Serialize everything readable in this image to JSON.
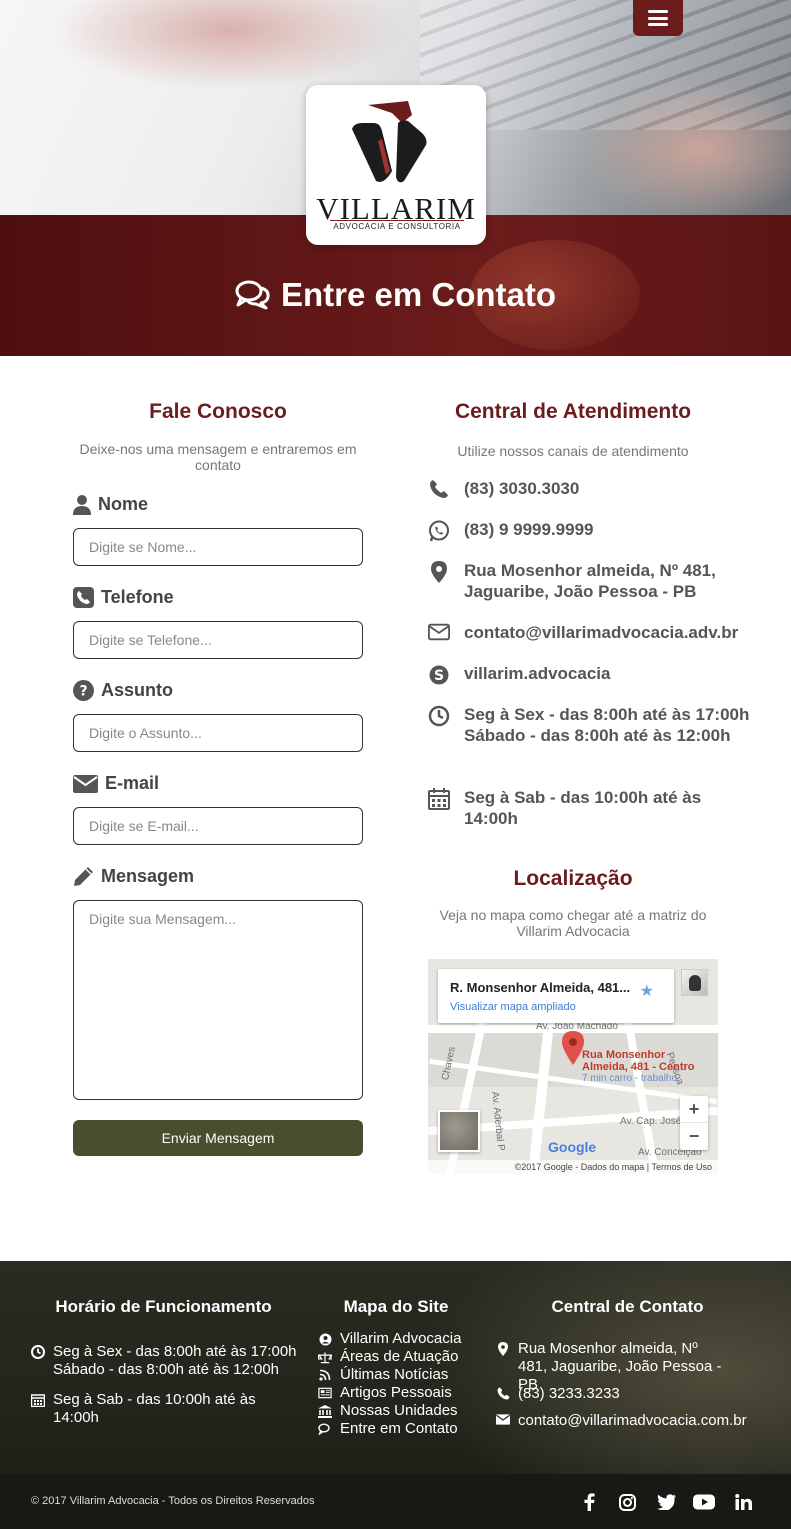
{
  "colors": {
    "brand": "#6b1d1d",
    "button": "#4a4d2e",
    "footer": "#25251d"
  },
  "hero": {
    "logo_name": "VILLARIM",
    "logo_sub": "ADVOCACIA E CONSULTORIA",
    "title": "Entre em Contato",
    "title_icon": "comments-icon",
    "menu_icon": "hamburger-icon"
  },
  "form": {
    "title": "Fale Conosco",
    "subtitle": "Deixe-nos uma mensagem e entraremos em contato",
    "fields": [
      {
        "label": "Nome",
        "icon": "user-icon",
        "placeholder": "Digite se Nome..."
      },
      {
        "label": "Telefone",
        "icon": "phone-square-icon",
        "placeholder": "Digite se Telefone..."
      },
      {
        "label": "Assunto",
        "icon": "question-circle-icon",
        "placeholder": "Digite o Assunto..."
      },
      {
        "label": "E-mail",
        "icon": "envelope-icon",
        "placeholder": "Digite se E-mail..."
      },
      {
        "label": "Mensagem",
        "icon": "pencil-icon",
        "placeholder": "Digite sua Mensagem..."
      }
    ],
    "submit": "Enviar Mensagem"
  },
  "service": {
    "title": "Central de Atendimento",
    "subtitle": "Utilize nossos canais de atendimento",
    "items": [
      {
        "icon": "phone-icon",
        "text": "(83) 3030.3030"
      },
      {
        "icon": "whatsapp-icon",
        "text": "(83) 9 9999.9999"
      },
      {
        "icon": "map-marker-icon",
        "text": "Rua Mosenhor almeida, Nº 481, Jaguaribe, João Pessoa - PB"
      },
      {
        "icon": "envelope-outline-icon",
        "text": "contato@villarimadvocacia.adv.br"
      },
      {
        "icon": "skype-icon",
        "text": "villarim.advocacia"
      },
      {
        "icon": "clock-icon",
        "text": "Seg à Sex - das 8:00h até às 17:00h",
        "text2": "Sábado - das 8:00h até às 12:00h"
      },
      {
        "icon": "calendar-icon",
        "text": "Seg à Sab - das 10:00h até às 14:00h"
      }
    ]
  },
  "location": {
    "title": "Localização",
    "subtitle": "Veja no mapa como chegar até a matriz do Villarim Advocacia",
    "map": {
      "address": "R. Monsenhor Almeida, 481...",
      "link": "Visualizar mapa ampliado",
      "pin_line1": "Rua Monsenhor",
      "pin_line2": "Almeida, 481 - Centro",
      "pin_time": "7 min carro - trabalho",
      "street1": "Av. João Machado",
      "street2": "Av. Aderbal P",
      "street3": "Av. Cap. José",
      "street4": "Chaves",
      "street5": "Av. Conceição",
      "street6": "Pessoa",
      "zoom_in": "+",
      "zoom_out": "−",
      "brand": "Google",
      "copyright": "©2017 Google - Dados do mapa",
      "terms": "Termos de Uso"
    }
  },
  "footer": {
    "hours": {
      "title": "Horário de Funcionamento",
      "row1": "Seg à Sex - das 8:00h até às 17:00h",
      "row1b": "Sábado - das 8:00h até às 12:00h",
      "row2": "Seg à Sab - das 10:00h até às 14:00h"
    },
    "sitemap": {
      "title": "Mapa do Site",
      "links": [
        {
          "icon": "user-circle-icon",
          "label": "Villarim Advocacia"
        },
        {
          "icon": "balance-scale-icon",
          "label": "Áreas de Atuação"
        },
        {
          "icon": "rss-icon",
          "label": "Últimas Notícias"
        },
        {
          "icon": "newspaper-icon",
          "label": "Artigos Pessoais"
        },
        {
          "icon": "bank-icon",
          "label": "Nossas Unidades"
        },
        {
          "icon": "comments-icon",
          "label": "Entre em Contato"
        }
      ]
    },
    "contact": {
      "title": "Central de Contato",
      "address": "Rua Mosenhor almeida, Nº 481, Jaguaribe, João Pessoa - PB",
      "phone": "(83) 3233.3233",
      "email": "contato@villarimadvocacia.com.br"
    },
    "copyright": "© 2017 Villarim Advocacia - Todos os Direitos Reservados",
    "social": [
      "facebook-icon",
      "instagram-icon",
      "twitter-icon",
      "youtube-icon",
      "linkedin-icon"
    ]
  }
}
